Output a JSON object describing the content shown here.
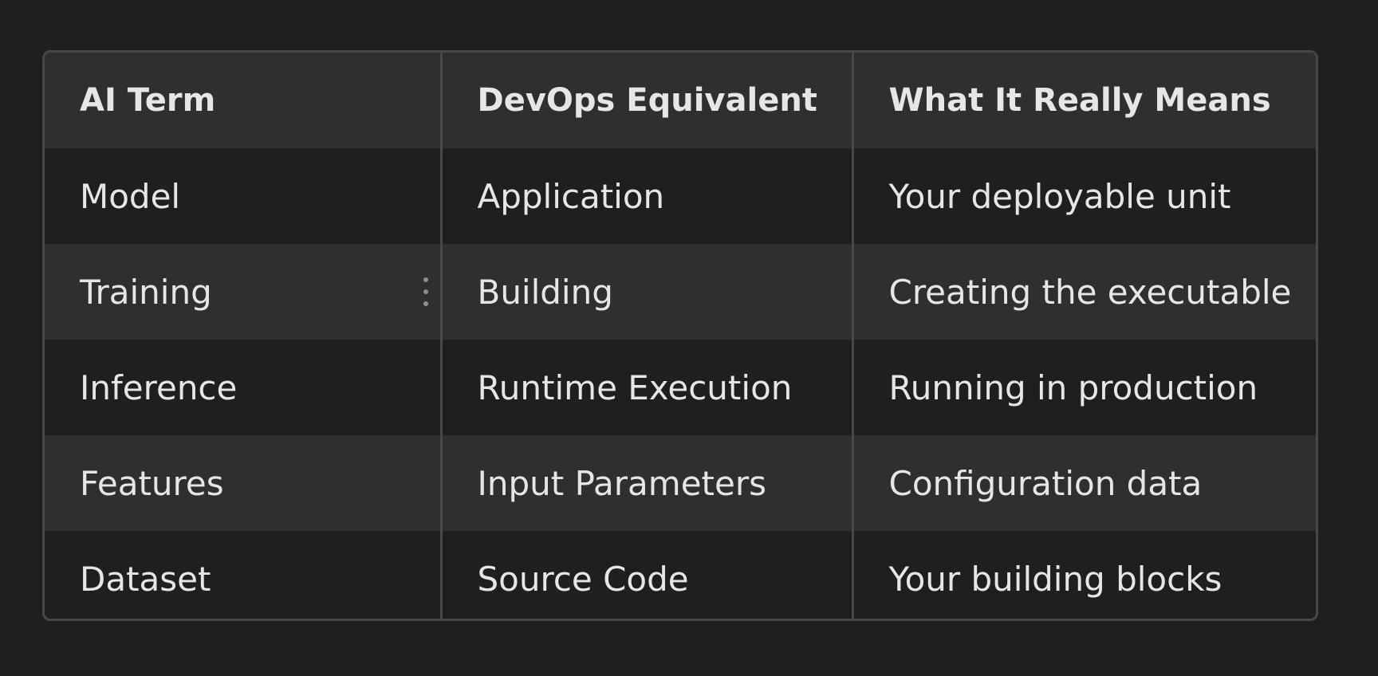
{
  "table": {
    "headers": [
      "AI Term",
      "DevOps Equivalent",
      "What It Really Means"
    ],
    "rows": [
      [
        "Model",
        "Application",
        "Your deployable unit"
      ],
      [
        "Training",
        "Building",
        "Creating the executable"
      ],
      [
        "Inference",
        "Runtime Execution",
        "Running in production"
      ],
      [
        "Features",
        "Input Parameters",
        "Configuration data"
      ],
      [
        "Dataset",
        "Source Code",
        "Your building blocks"
      ]
    ]
  },
  "drag_handle_icon": "vertical-ellipsis-icon",
  "colors": {
    "background": "#1e1f21",
    "header_row": "#2e2f31",
    "striped_row": "#2e2f31",
    "border": "#46484b",
    "text": "#e6e6e4"
  }
}
